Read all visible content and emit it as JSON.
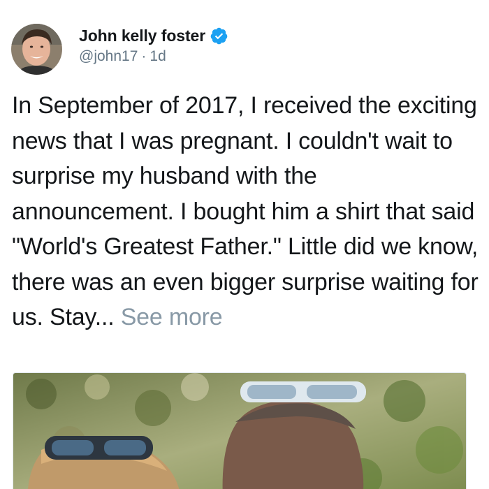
{
  "tweet": {
    "author": {
      "display_name": "John kelly foster",
      "handle": "@john17",
      "separator": "·",
      "time_ago": "1d",
      "verified": true,
      "avatar_icon": "profile-photo"
    },
    "text": "In September of 2017, I received the exciting news that I was pregnant. I couldn't wait to surprise my husband with the announcement. I bought him a shirt that said \"World's Greatest Father.\" Little did we know, there was an even bigger surprise waiting for us. Stay...",
    "see_more_label": "See more",
    "media": {
      "icon": "photo"
    }
  },
  "colors": {
    "name": "#14171a",
    "meta": "#657786",
    "see_more": "#8899a6",
    "verified": "#1da1f2"
  }
}
